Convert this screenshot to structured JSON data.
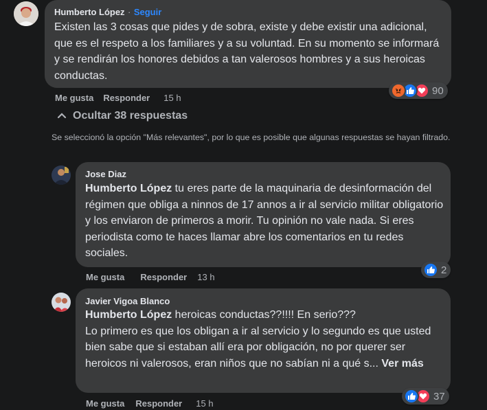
{
  "comment": {
    "author": "Humberto López",
    "separator": "·",
    "follow_label": "Seguir",
    "text": "Existen las 3 cosas que pides y de sobra, existe y debe existir una adicional, que es el respeto a los familiares y a su voluntad. En su momento se informará y se rendirán los honores debidos a tan valerosos hombres y a sus heroicas conductas.",
    "like_label": "Me gusta",
    "reply_label": "Responder",
    "time": "15 h",
    "reaction_count": "90",
    "reactions": [
      "angry-icon",
      "like-icon",
      "love-icon"
    ]
  },
  "replies_toggle": {
    "label": "Ocultar 38 respuestas",
    "icon": "chevron-up-icon"
  },
  "filter_notice": "Se seleccionó la opción \"Más relevantes\", por lo que es posible que algunas respuestas se hayan filtrado.",
  "replies": [
    {
      "author": "Jose Diaz",
      "mention": "Humberto López",
      "text": " tu eres parte de la maquinaria de desinformación del régimen que obliga a ninnos de 17 annos a ir al servicio militar obligatorio y los enviaron de primeros a morir. Tu opinión no vale nada. Si eres periodista como te haces llamar abre los comentarios en tu redes sociales.",
      "like_label": "Me gusta",
      "reply_label": "Responder",
      "time": "13 h",
      "reaction_count": "2",
      "reactions": [
        "like-icon"
      ]
    },
    {
      "author": "Javier Vigoa Blanco",
      "mention": "Humberto López",
      "text": " heroicas conductas??!!!! En serio???",
      "text2": "Lo primero es que los obligan a ir al servicio y lo segundo es que usted bien sabe que si estaban allí era por obligación, no por querer ser heroicos ni valerosos, eran niños que no sabían ni a qué s...",
      "see_more": "Ver más",
      "like_label": "Me gusta",
      "reply_label": "Responder",
      "time": "15 h",
      "reaction_count": "37",
      "reactions": [
        "like-icon",
        "love-icon"
      ]
    }
  ],
  "colors": {
    "background": "#18191a",
    "bubble": "#3a3b3c",
    "link": "#2d88ff",
    "secondary_text": "#b0b3b8"
  }
}
